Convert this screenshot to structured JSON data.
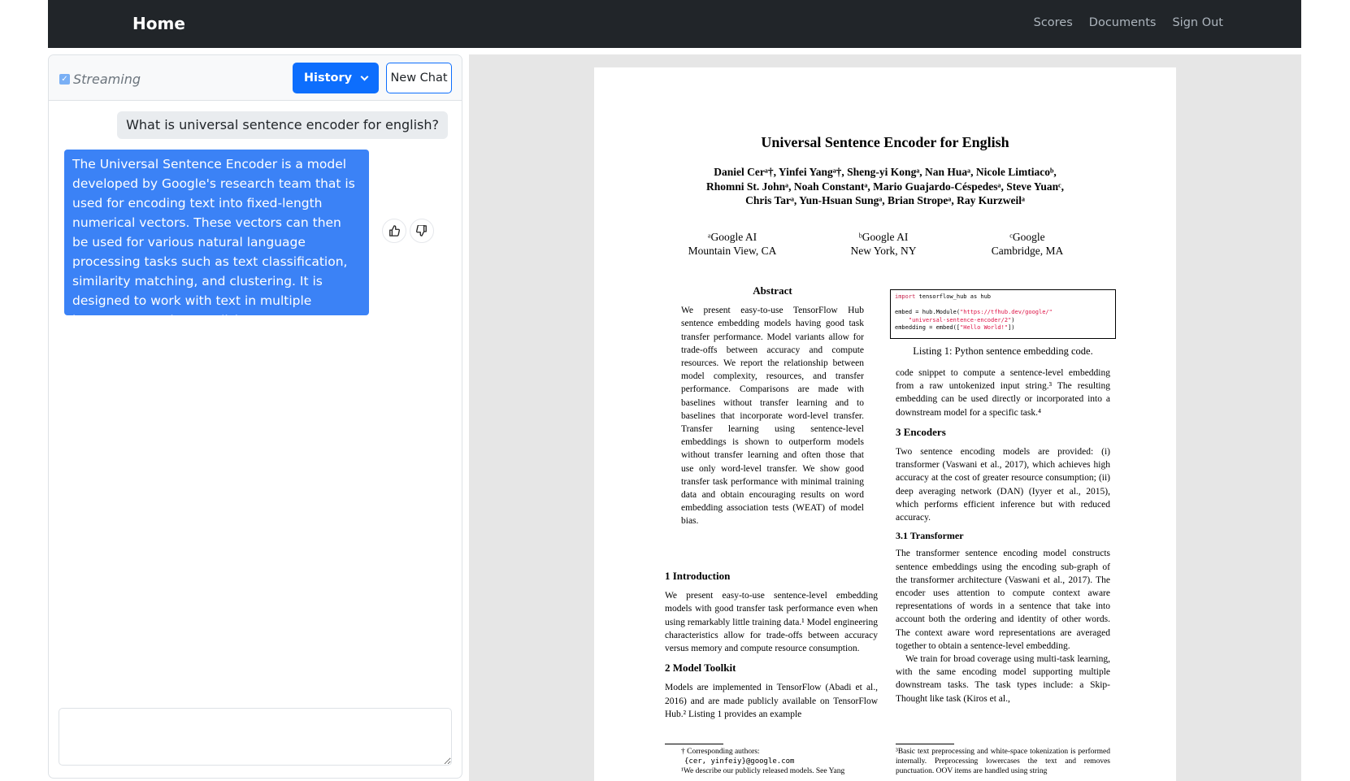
{
  "navbar": {
    "brand": "Home",
    "links": [
      "Scores",
      "Documents",
      "Sign Out"
    ]
  },
  "chat": {
    "streaming_label": "Streaming",
    "streaming_checked": true,
    "history_label": "History",
    "new_chat_label": "New Chat",
    "messages": [
      {
        "role": "user",
        "text": "What is universal sentence encoder for english?"
      },
      {
        "role": "assistant",
        "text": "The Universal Sentence Encoder is a model developed by Google's research team that is used for encoding text into fixed-length numerical vectors. These vectors can then be used for various natural language processing tasks such as text classification, similarity matching, and clustering. It is designed to work with text in multiple languages, not just English."
      }
    ],
    "input_value": "",
    "icons": [
      "thumbs-up-icon",
      "thumbs-down-icon",
      "chevron-down-icon"
    ],
    "accent_color": "#0d6efd"
  },
  "document": {
    "title": "Universal Sentence Encoder for English",
    "authors_line1": "Daniel Cerᵃ†, Yinfei Yangᵃ†, Sheng-yi Kongᵃ, Nan Huaᵃ, Nicole Limtiacoᵇ,",
    "authors_line2": "Rhomni St. Johnᵃ, Noah Constantᵃ, Mario Guajardo-Céspedesᵃ, Steve Yuanᶜ,",
    "authors_line3": "Chris Tarᵃ, Yun-Hsuan Sungᵃ, Brian Stropeᵃ, Ray Kurzweilᵃ",
    "affiliations": [
      {
        "name": "ᵃGoogle AI",
        "place": "Mountain View, CA"
      },
      {
        "name": "ᵇGoogle AI",
        "place": "New York, NY"
      },
      {
        "name": "ᶜGoogle",
        "place": "Cambridge, MA"
      }
    ],
    "abstract_heading": "Abstract",
    "abstract": "We present easy-to-use TensorFlow Hub sentence embedding models having good task transfer performance. Model variants allow for trade-offs between accuracy and compute resources. We report the relationship between model complexity, resources, and transfer performance. Comparisons are made with baselines without transfer learning and to baselines that incorporate word-level transfer. Transfer learning using sentence-level embeddings is shown to outperform models without transfer learning and often those that use only word-level transfer. We show good transfer task performance with minimal training data and obtain encouraging results on word embedding association tests (WEAT) of model bias.",
    "intro_heading": "1   Introduction",
    "intro_text": "We present easy-to-use sentence-level embedding models with good transfer task performance even when using remarkably little training data.¹ Model engineering characteristics allow for trade-offs between accuracy versus memory and compute resource consumption.",
    "toolkit_heading": "2   Model Toolkit",
    "toolkit_text": "Models are implemented in TensorFlow (Abadi et al., 2016) and are made publicly available on TensorFlow Hub.² Listing 1 provides an example",
    "footnote_left_1": "† Corresponding authors:",
    "footnote_left_2": "{cer, yinfeiy}@google.com",
    "footnote_left_3": "¹We describe our publicly released models. See Yang",
    "code_line1_kw": "import",
    "code_line1_rest": " tensorflow_hub as hub",
    "code_line2a": "embed = hub.Module(",
    "code_line2b": "\"https://tfhub.dev/google/\"",
    "code_line3": "    \"universal-sentence-encoder/2\"",
    "code_line3_end": ")",
    "code_line4a": "embedding = embed([",
    "code_line4b": "\"Hello World!\"",
    "code_line4c": "])",
    "listing_caption": "Listing 1: Python sentence embedding code.",
    "right_text_1": "code snippet to compute a sentence-level embedding from a raw untokenized input string.³ The resulting embedding can be used directly or incorporated into a downstream model for a specific task.⁴",
    "encoders_heading": "3   Encoders",
    "encoders_text": "Two sentence encoding models are provided: (i) transformer (Vaswani et al., 2017), which achieves high accuracy at the cost of greater resource consumption; (ii) deep averaging network (DAN) (Iyyer et al., 2015), which performs efficient inference but with reduced accuracy.",
    "transformer_heading": "3.1   Transformer",
    "transformer_text_1": "The transformer sentence encoding model constructs sentence embeddings using the encoding sub-graph of the transformer architecture (Vaswani et al., 2017). The encoder uses attention to compute context aware representations of words in a sentence that take into account both the ordering and identity of other words. The context aware word representations are averaged together to obtain a sentence-level embedding.",
    "transformer_text_2": "We train for broad coverage using multi-task learning, with the same encoding model supporting multiple downstream tasks. The task types include: a Skip-Thought like task (Kiros et al.,",
    "footnote_right": "³Basic text preprocessing and white-space tokenization is performed internally. Preprocessing lowercases the text and removes punctuation. OOV items are handled using string"
  }
}
